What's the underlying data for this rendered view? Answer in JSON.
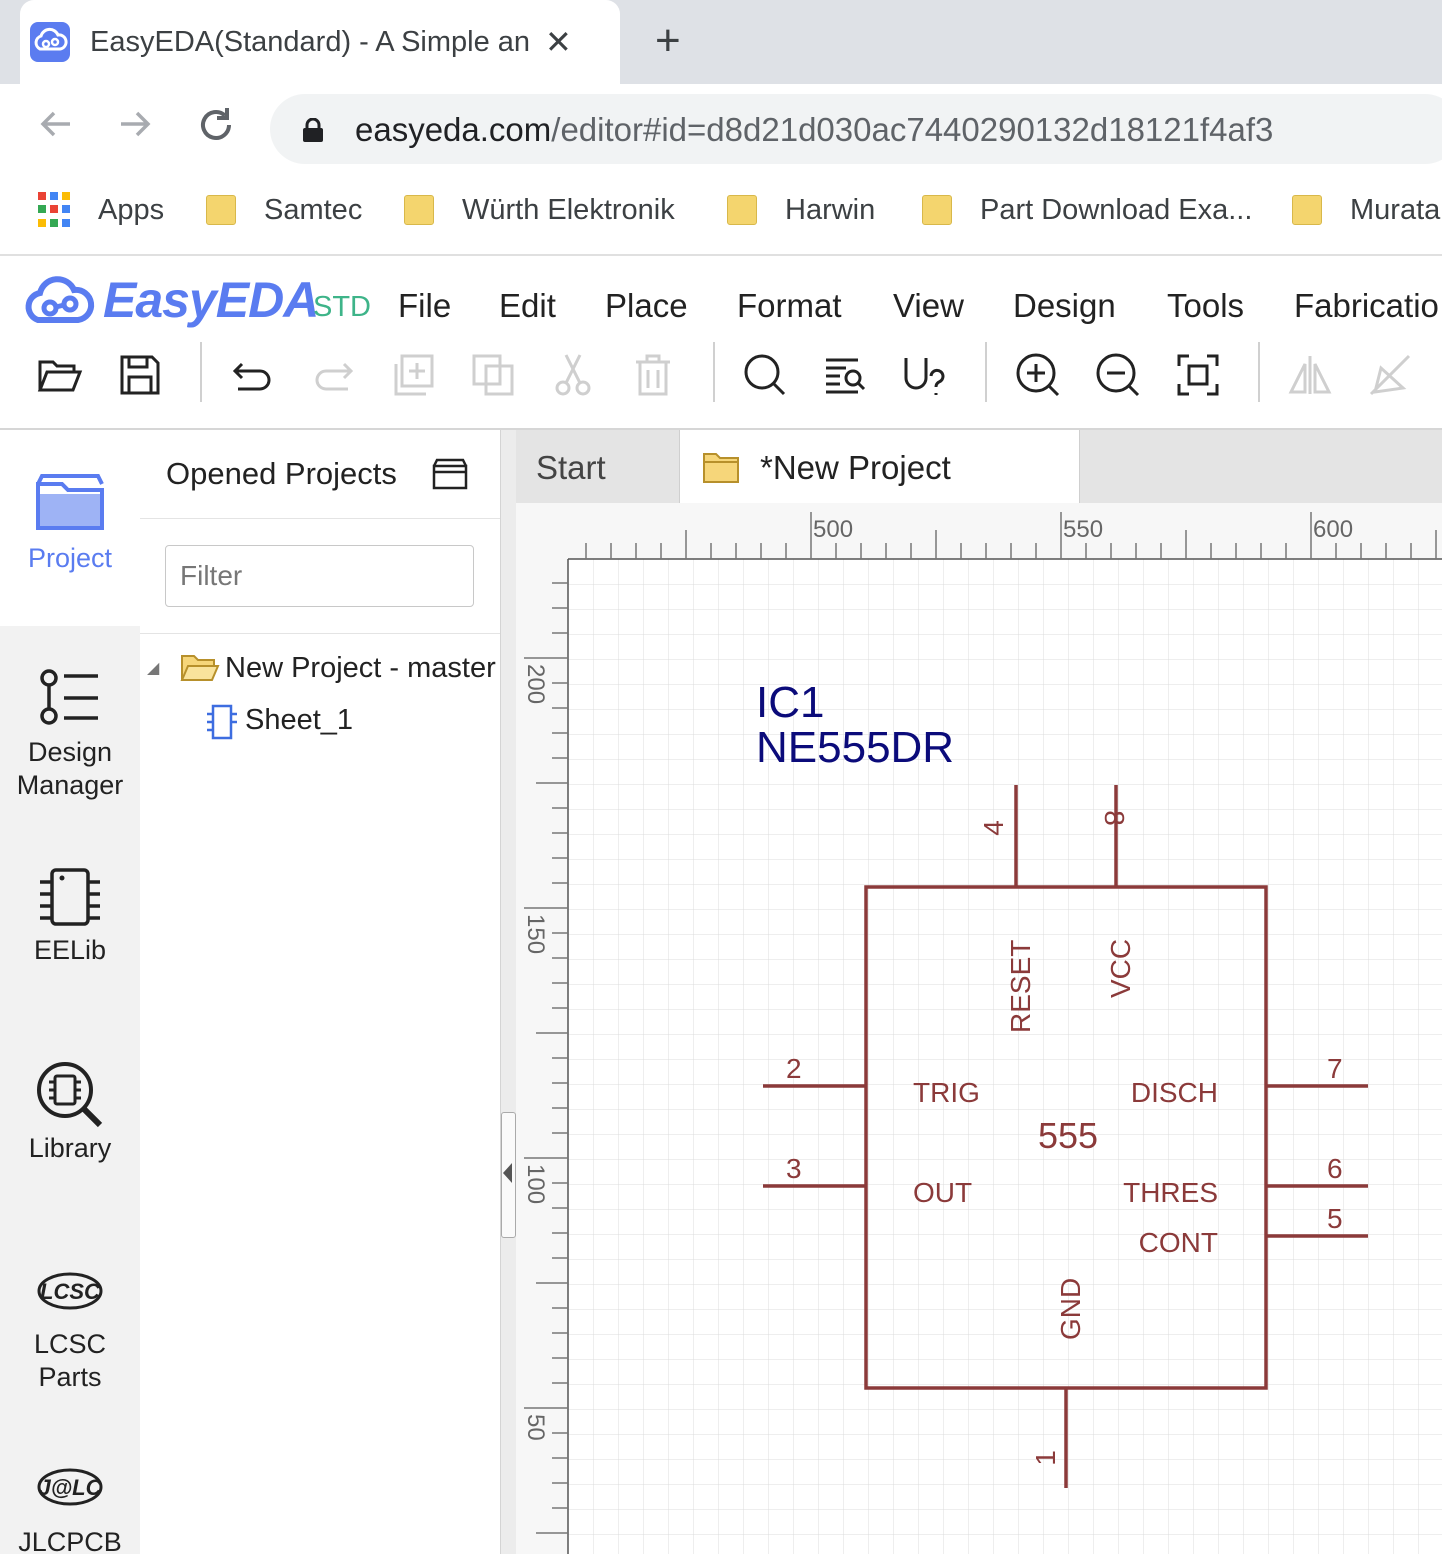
{
  "browser": {
    "tab_title": "EasyEDA(Standard) - A Simple and Powerful Electronic Circuit Design Tool",
    "url_host": "easyeda.com",
    "url_path": "/editor#id=d8d21d030ac7440290132d18121f4af3",
    "bookmarks": [
      {
        "label": "Apps",
        "icon": "apps-grid-icon"
      },
      {
        "label": "Samtec",
        "icon": "folder-icon"
      },
      {
        "label": "Würth Elektronik",
        "icon": "folder-icon"
      },
      {
        "label": "Harwin",
        "icon": "folder-icon"
      },
      {
        "label": "Part Download Exa...",
        "icon": "folder-icon"
      },
      {
        "label": "Murata",
        "icon": "folder-icon"
      }
    ]
  },
  "app": {
    "logo_text": "EasyEDA",
    "logo_suffix": "STD",
    "brand_color": "#5a7cf0",
    "menu": [
      "File",
      "Edit",
      "Place",
      "Format",
      "View",
      "Design",
      "Tools",
      "Fabricatio"
    ]
  },
  "toolbar": {
    "icons": [
      "open-folder-icon",
      "save-icon",
      "undo-icon",
      "redo-icon",
      "duplicate-icon",
      "copy-icon",
      "cut-icon",
      "delete-icon",
      "search-icon",
      "find-list-icon",
      "unknown-part-icon",
      "zoom-in-icon",
      "zoom-out-icon",
      "fit-view-icon",
      "flip-horizontal-icon",
      "flip-vertical-icon"
    ]
  },
  "leftnav": [
    {
      "label": "Project",
      "icon": "project-folder-icon",
      "active": true
    },
    {
      "label": "Design Manager",
      "icon": "design-manager-icon",
      "active": false
    },
    {
      "label": "EELib",
      "icon": "chip-icon",
      "active": false
    },
    {
      "label": "Library",
      "icon": "library-search-icon",
      "active": false
    },
    {
      "label": "LCSC Parts",
      "icon": "lcsc-logo-icon",
      "active": false
    },
    {
      "label": "JLCPCB",
      "icon": "jlc-logo-icon",
      "active": false
    }
  ],
  "project_panel": {
    "title": "Opened Projects",
    "filter_placeholder": "Filter",
    "tree": {
      "project": "New Project - master",
      "sheets": [
        "Sheet_1"
      ]
    }
  },
  "doc_tabs": {
    "start": "Start",
    "active": "*New Project"
  },
  "ruler": {
    "top_labels": [
      "500",
      "550",
      "600"
    ],
    "left_labels": [
      "200",
      "150",
      "100",
      "50"
    ]
  },
  "schematic": {
    "designator": "IC1",
    "part_name": "NE555DR",
    "body_label": "555",
    "wire_color": "#8b3a3a",
    "label_color": "#0b0b7a",
    "pins": [
      {
        "number": "4",
        "name": "RESET"
      },
      {
        "number": "8",
        "name": "VCC"
      },
      {
        "number": "2",
        "name": "TRIG"
      },
      {
        "number": "7",
        "name": "DISCH"
      },
      {
        "number": "3",
        "name": "OUT"
      },
      {
        "number": "6",
        "name": "THRES"
      },
      {
        "number": "5",
        "name": "CONT"
      },
      {
        "number": "1",
        "name": "GND"
      }
    ]
  }
}
